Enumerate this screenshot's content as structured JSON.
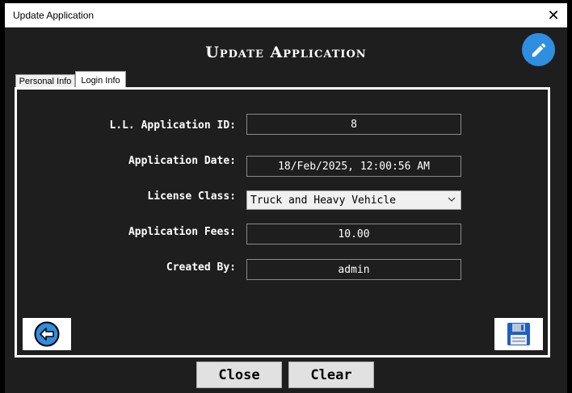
{
  "window": {
    "title": "Update Application"
  },
  "header": {
    "title": "Update Application"
  },
  "tabs": [
    {
      "label": "Personal Info"
    },
    {
      "label": "Login Info"
    }
  ],
  "form": {
    "fields": [
      {
        "label": "L.L. Application ID:",
        "value": "8"
      },
      {
        "label": "Application Date:",
        "value": "18/Feb/2025, 12:00:56 AM"
      },
      {
        "label": "License Class:",
        "value": "Truck and Heavy Vehicle"
      },
      {
        "label": "Application Fees:",
        "value": "10.00"
      },
      {
        "label": "Created By:",
        "value": "admin"
      }
    ]
  },
  "buttons": {
    "close": "Close",
    "clear": "Clear"
  },
  "icons": {
    "edit": "pencil-icon",
    "back": "back-arrow-icon",
    "save": "floppy-disk-icon",
    "close": "close-icon"
  },
  "colors": {
    "accent": "#2f8ee0",
    "background": "#1e1e1e"
  }
}
